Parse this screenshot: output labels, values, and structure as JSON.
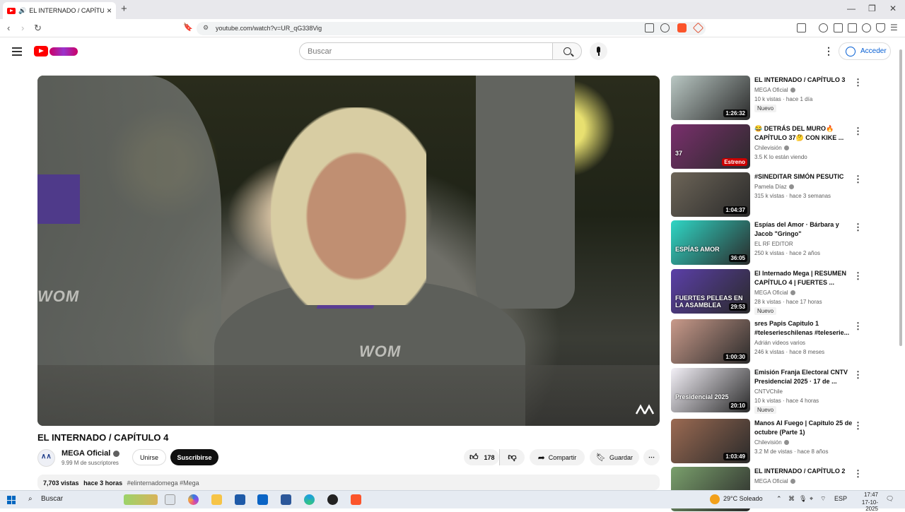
{
  "browser": {
    "tab_title": "EL INTERNADO / CAPÍTULO 4",
    "new_tab": "+",
    "url": "youtube.com/watch?v=UR_qG338Vig",
    "window_controls": [
      "—",
      "❐",
      "✕"
    ]
  },
  "header": {
    "search_placeholder": "Buscar",
    "signin_label": "Acceder"
  },
  "video": {
    "title": "EL INTERNADO / CAPÍTULO 4",
    "channel": "MEGA Oficial",
    "subscribers": "9.99 M de suscriptores",
    "join_label": "Unirse",
    "subscribe_label": "Suscribirse",
    "likes": "178",
    "share_label": "Compartir",
    "save_label": "Guardar",
    "views": "7,703 vistas",
    "age": "hace 3 horas",
    "tags": "#elinternadomega #Mega",
    "watermark": [
      "WOM",
      "WOM"
    ]
  },
  "recommendations": [
    {
      "title": "EL INTERNADO / CAPÍTULO 3",
      "channel": "MEGA Oficial",
      "verified": true,
      "stats": "10 k vistas · hace 1 día",
      "badge": "Nuevo",
      "duration": "1:26:32",
      "color": "#b9c7c3"
    },
    {
      "title": "😂 DETRÁS DEL MURO🔥 CAPÍTULO 37🤔 CON KIKE ...",
      "channel": "Chilevisión",
      "verified": true,
      "stats": "3.5 K lo están viendo",
      "badge": "",
      "duration": "",
      "live": "Estreno",
      "thumb_text": "37",
      "color": "#7a2f6d"
    },
    {
      "title": "#SINEDITAR SIMÓN PESUTIC",
      "channel": "Pamela Díaz",
      "verified": true,
      "stats": "315 k vistas · hace 3 semanas",
      "badge": "",
      "duration": "1:04:37",
      "color": "#6d6558"
    },
    {
      "title": "Espías del Amor · Bárbara y Jacob \"Gringo\"",
      "channel": "EL RF EDITOR",
      "verified": false,
      "stats": "250 k vistas · hace 2 años",
      "badge": "",
      "duration": "36:05",
      "thumb_text": "ESPÍAS AMOR",
      "color": "#2fd6c5"
    },
    {
      "title": "El Internado Mega | RESUMEN CAPÍTULO 4 | FUERTES ...",
      "channel": "MEGA Oficial",
      "verified": true,
      "stats": "28 k vistas · hace 17 horas",
      "badge": "Nuevo",
      "duration": "29:53",
      "thumb_text": "FUERTES PELEAS EN LA ASAMBLEA",
      "color": "#5b3fa8"
    },
    {
      "title": "sres Papis Capitulo 1 #teleserieschilenas #teleserie...",
      "channel": "Adrián videos varios",
      "verified": false,
      "stats": "246 k vistas · hace 8 meses",
      "badge": "",
      "duration": "1:00:30",
      "color": "#c99a8a"
    },
    {
      "title": "Emisión Franja Electoral CNTV Presidencial 2025 · 17 de ...",
      "channel": "CNTVChile",
      "verified": false,
      "stats": "10 k vistas · hace 4 horas",
      "badge": "Nuevo",
      "duration": "20:10",
      "thumb_text": "Presidencial 2025",
      "color": "#f3f0f7"
    },
    {
      "title": "Manos Al Fuego | Capitulo 25 de octubre (Parte 1)",
      "channel": "Chilevisión",
      "verified": true,
      "stats": "3.2 M de vistas · hace 8 años",
      "badge": "",
      "duration": "1:03:49",
      "color": "#9b6a52"
    },
    {
      "title": "EL INTERNADO / CAPÍTULO 2",
      "channel": "MEGA Oficial",
      "verified": true,
      "stats": "",
      "badge": "",
      "duration": "",
      "color": "#7aa06c"
    }
  ],
  "taskbar": {
    "search_label": "Buscar",
    "weather": "29°C Soleado",
    "lang": "ESP",
    "time": "17:47",
    "date": "17-10-2025"
  }
}
